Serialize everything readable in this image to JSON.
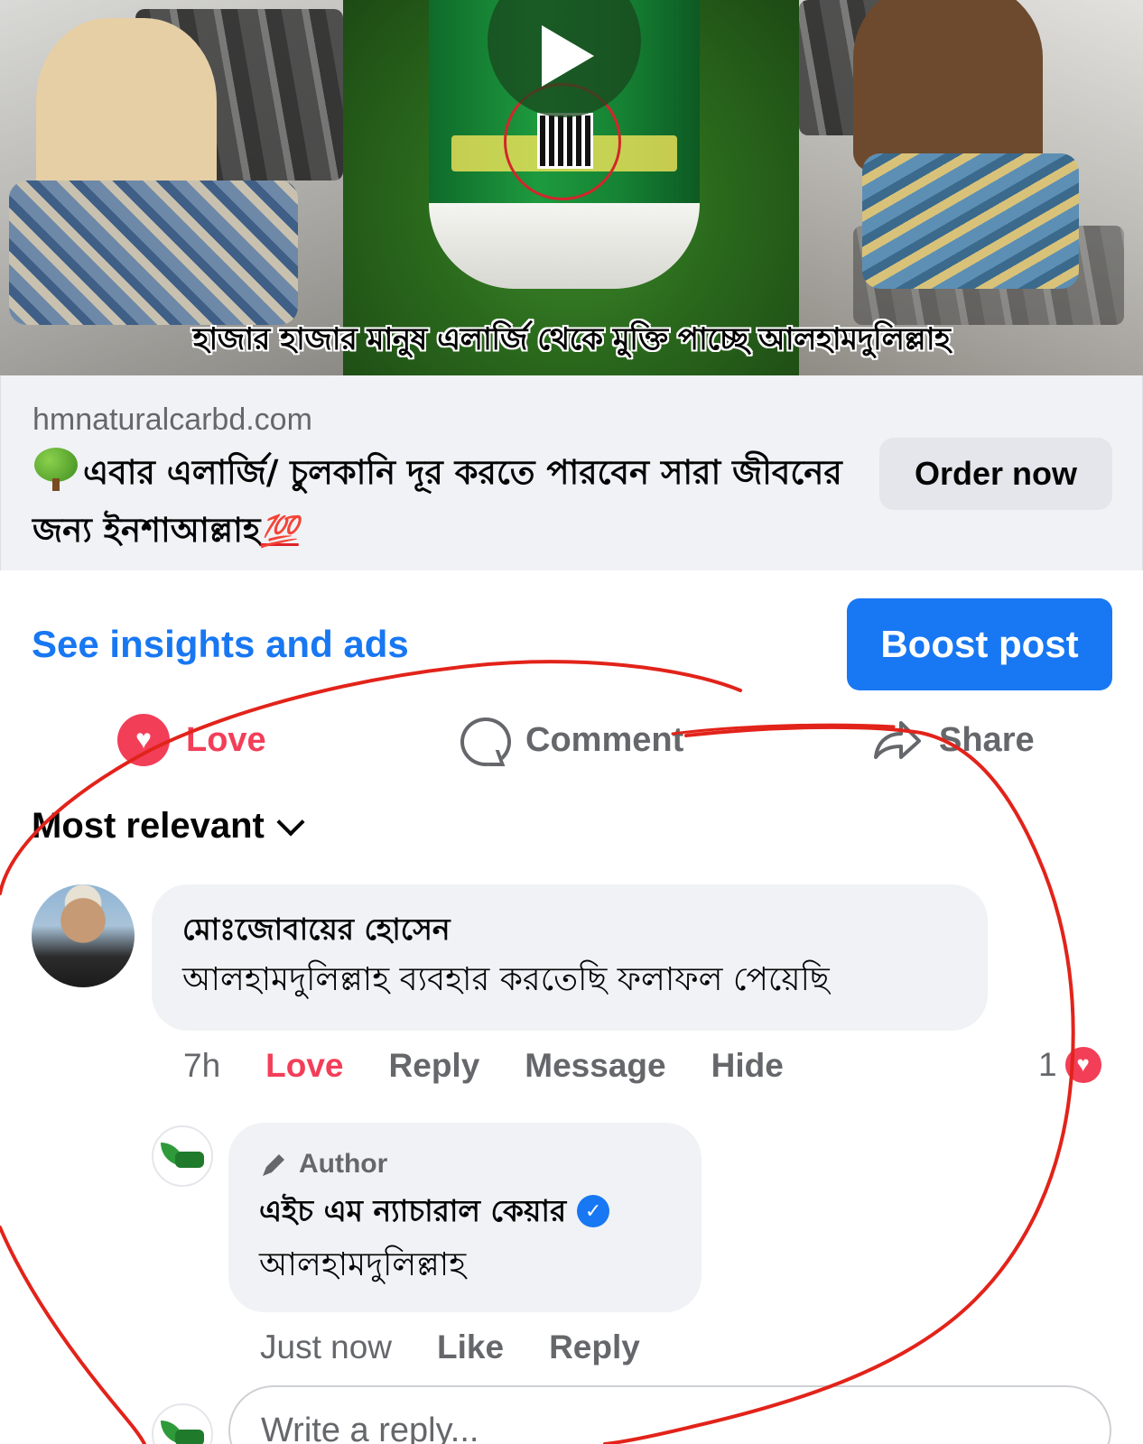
{
  "media": {
    "caption": "হাজার হাজার মানুষ এলার্জি থেকে মুক্তি পাচ্ছে আলহামদুলিল্লাহ"
  },
  "link_preview": {
    "domain": "hmnaturalcarbd.com",
    "title": "এবার এলার্জি/ চুলকানি দূর করতে পারবেন সারা জীবনের জন্য ইনশাআল্লাহ",
    "title_emoji": "💯",
    "cta_label": "Order now"
  },
  "insights": {
    "link_label": "See insights and ads",
    "boost_label": "Boost post"
  },
  "actions": {
    "love_label": "Love",
    "comment_label": "Comment",
    "share_label": "Share"
  },
  "sort": {
    "label": "Most relevant"
  },
  "comment": {
    "author": "মোঃজোবায়ের হোসেন",
    "text": "আলহামদুলিল্লাহ ব্যবহার করতেছি ফলাফল পেয়েছি",
    "time": "7h",
    "love_label": "Love",
    "reply_label": "Reply",
    "message_label": "Message",
    "hide_label": "Hide",
    "reaction_count": "1"
  },
  "reply": {
    "badge": "Author",
    "author": "এইচ এম ন্যাচারাল কেয়ার",
    "text": "আলহামদুলিল্লাহ",
    "time": "Just now",
    "like_label": "Like",
    "reply_label": "Reply"
  },
  "composer": {
    "placeholder": "Write a reply..."
  },
  "colors": {
    "accent": "#1877f2",
    "love": "#f33e58",
    "annotation": "#e2231a"
  }
}
